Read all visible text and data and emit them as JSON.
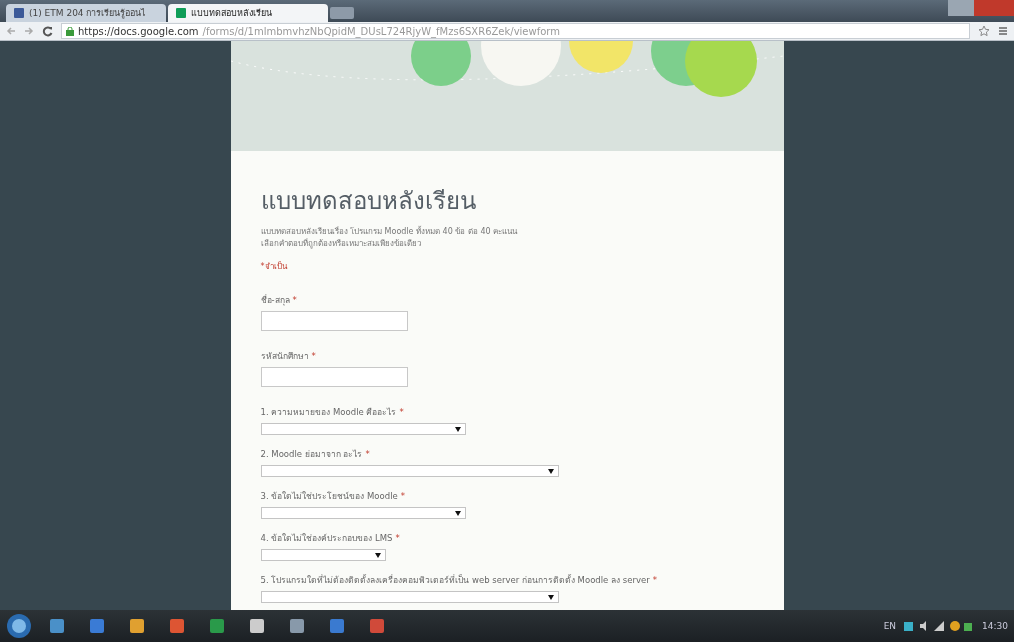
{
  "browser": {
    "tabs": [
      {
        "title": "(1) ETM 204 การเรียนรู้ออนไ",
        "selected": false
      },
      {
        "title": "แบบทดสอบหลังเรียน",
        "selected": true
      }
    ],
    "url_host": "https://docs.google.com",
    "url_path": "/forms/d/1mlmbmvhzNbQpidM_DUsL724RjyW_fMzs6SXR6Zek/viewform"
  },
  "form": {
    "title": "แบบทดสอบหลังเรียน",
    "description": [
      "แบบทดสอบหลังเรียนเรื่อง โปรแกรม Moodle ทั้งหมด 40 ข้อ ต่อ 40 คะแนน",
      "เลือกคำตอบที่ถูกต้องหรือเหมาะสมเพียงข้อเดียว"
    ],
    "required_note": "*จำเป็น",
    "questions": [
      {
        "kind": "text",
        "label": "ชื่อ-สกุล",
        "required_mark": "*"
      },
      {
        "kind": "text",
        "label": "รหัสนักศึกษา",
        "required_mark": "*"
      },
      {
        "kind": "select",
        "label": "1. ความหมายของ Moodle คืออะไร",
        "required_mark": "*"
      },
      {
        "kind": "wideselect",
        "label": "2. Moodle ย่อมาจาก อะไร",
        "required_mark": "*"
      },
      {
        "kind": "select",
        "label": "3. ข้อใดไม่ใช่ประโยชน์ของ Moodle",
        "required_mark": "*"
      },
      {
        "kind": "narrowselect",
        "label": "4. ข้อใดไม่ใช่องค์ประกอบของ LMS",
        "required_mark": "*"
      },
      {
        "kind": "wideselect",
        "label": "5. โปรแกรมใดที่ไม่ต้องติดตั้งลงเครื่องคอมพิวเตอร์ที่เป็น web server ก่อนการติดตั้ง Moodle ลง server",
        "required_mark": "*"
      }
    ]
  },
  "taskbar": {
    "language": "EN",
    "time": "14:30"
  }
}
